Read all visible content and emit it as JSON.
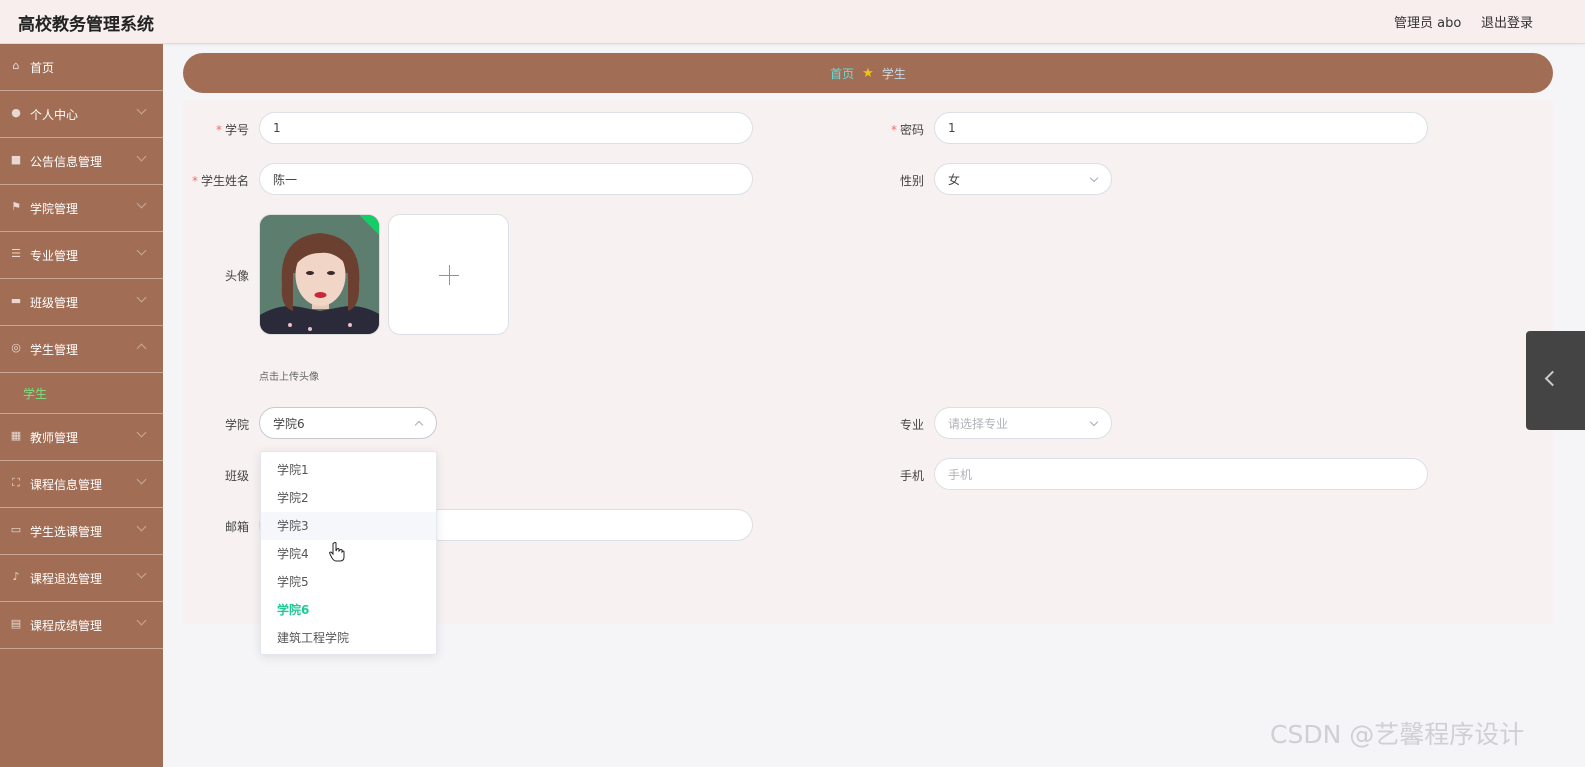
{
  "header": {
    "title": "高校教务管理系统",
    "admin": "管理员 abo",
    "logout": "退出登录"
  },
  "sidebar": {
    "items": [
      {
        "label": "首页",
        "icon": "home-icon"
      },
      {
        "label": "个人中心",
        "icon": "user-icon"
      },
      {
        "label": "公告信息管理",
        "icon": "briefcase-icon"
      },
      {
        "label": "学院管理",
        "icon": "flag-icon"
      },
      {
        "label": "专业管理",
        "icon": "sliders-icon"
      },
      {
        "label": "班级管理",
        "icon": "monitor-icon"
      },
      {
        "label": "学生管理",
        "icon": "globe-icon"
      },
      {
        "label": "教师管理",
        "icon": "bank-icon"
      },
      {
        "label": "课程信息管理",
        "icon": "fullscreen-icon"
      },
      {
        "label": "学生选课管理",
        "icon": "ticket-icon"
      },
      {
        "label": "课程退选管理",
        "icon": "mic-icon"
      },
      {
        "label": "课程成绩管理",
        "icon": "clipboard-icon"
      }
    ],
    "sub_item": "学生"
  },
  "breadcrumb": {
    "home": "首页",
    "current": "学生"
  },
  "form": {
    "student_id_label": "学号",
    "student_id_value": "1",
    "password_label": "密码",
    "password_value": "1",
    "name_label": "学生姓名",
    "name_value": "陈一",
    "gender_label": "性别",
    "gender_value": "女",
    "avatar_label": "头像",
    "avatar_tip": "点击上传头像",
    "college_label": "学院",
    "college_value": "学院6",
    "major_label": "专业",
    "major_placeholder": "请选择专业",
    "class_label": "班级",
    "phone_label": "手机",
    "phone_placeholder": "手机",
    "email_label": "邮箱"
  },
  "dropdown": {
    "options": [
      "学院1",
      "学院2",
      "学院3",
      "学院4",
      "学院5",
      "学院6",
      "建筑工程学院"
    ],
    "selected": "学院6",
    "hovered": "学院3"
  },
  "watermark": "CSDN @艺馨程序设计",
  "colors": {
    "sidebar": "#a16e55",
    "accent_selected": "#20c997",
    "required": "#f56c6c",
    "check": "#13ce66"
  }
}
